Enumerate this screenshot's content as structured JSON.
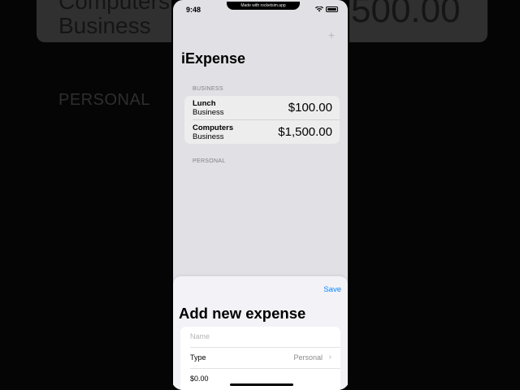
{
  "backdrop": {
    "text_top": "Computers",
    "text_business": "Business",
    "section_personal": "PERSONAL",
    "amount": "500.00"
  },
  "status_bar": {
    "time": "9:48",
    "made_with": "Made with rocketsim.app"
  },
  "nav": {
    "title": "iExpense",
    "add_icon": "plus-icon"
  },
  "sections": {
    "business": {
      "header": "BUSINESS",
      "items": [
        {
          "name": "Lunch",
          "type": "Business",
          "amount": "$100.00"
        },
        {
          "name": "Computers",
          "type": "Business",
          "amount": "$1,500.00"
        }
      ]
    },
    "personal": {
      "header": "PERSONAL"
    }
  },
  "sheet": {
    "save_label": "Save",
    "title": "Add new expense",
    "name_placeholder": "Name",
    "type_label": "Type",
    "type_value": "Personal",
    "amount_value": "$0.00"
  },
  "colors": {
    "accent": "#0a84ff",
    "background": "#f2f2f7"
  }
}
